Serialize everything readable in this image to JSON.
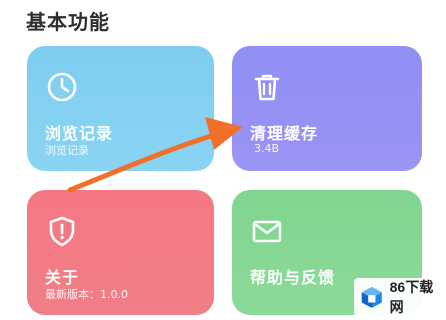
{
  "section": {
    "title": "基本功能"
  },
  "cards": {
    "history": {
      "title": "浏览记录",
      "subtitle": "浏览记录",
      "icon": "clock-icon",
      "color": "#7ecdf0"
    },
    "cache": {
      "title": "清理缓存",
      "subtitle": "3.4B",
      "icon": "trash-icon",
      "color": "#8f8ff4"
    },
    "about": {
      "title": "关于",
      "subtitle": "最新版本：1.0.0",
      "icon": "shield-alert-icon",
      "color": "#f47884"
    },
    "help": {
      "title": "帮助与反馈",
      "subtitle": "",
      "icon": "mail-icon",
      "color": "#7fd58f"
    }
  },
  "overlay": {
    "arrow_color": "#f0702a"
  },
  "watermark": {
    "text": "86下载网"
  }
}
